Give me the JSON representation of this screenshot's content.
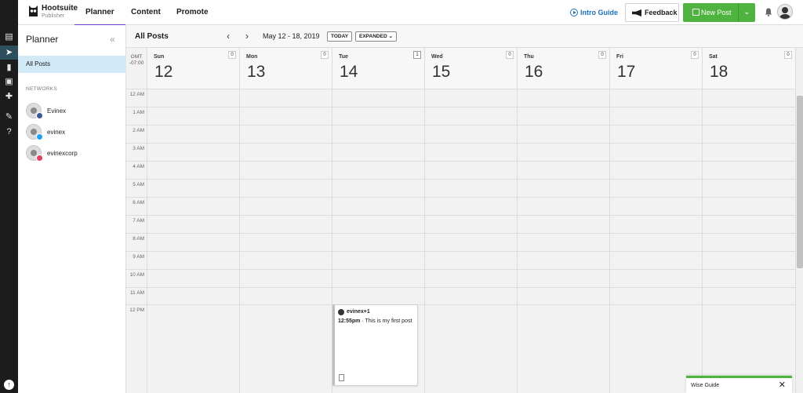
{
  "header": {
    "brand": "Hootsuite",
    "brand_sub": "Publisher",
    "tabs": [
      {
        "label": "Planner",
        "active": true
      },
      {
        "label": "Content",
        "active": false
      },
      {
        "label": "Promote",
        "active": false
      }
    ],
    "intro_guide": "Intro Guide",
    "feedback": "Feedback",
    "new_post": "New Post",
    "new_post_dropdown": "⌄",
    "accent_color": "#4fb33f"
  },
  "sidebar": {
    "title": "Planner",
    "collapse": "«",
    "all_posts": "All Posts",
    "networks_label": "NETWORKS",
    "networks": [
      {
        "name": "Evinex",
        "network": "facebook",
        "color": "#3b5998"
      },
      {
        "name": "evinex",
        "network": "twitter",
        "color": "#1da1f2"
      },
      {
        "name": "evinexcorp",
        "network": "instagram",
        "color": "#e4405f"
      }
    ]
  },
  "calendar": {
    "title": "All Posts",
    "prev": "‹",
    "next": "›",
    "range": "May 12 - 18, 2019",
    "today": "TODAY",
    "view": "EXPANDED",
    "view_caret": "⌄",
    "timezone_line1": "GMT",
    "timezone_line2": "-07:00",
    "days": [
      {
        "name": "Sun",
        "num": "12",
        "count": "0"
      },
      {
        "name": "Mon",
        "num": "13",
        "count": "0"
      },
      {
        "name": "Tue",
        "num": "14",
        "count": "1"
      },
      {
        "name": "Wed",
        "num": "15",
        "count": "0"
      },
      {
        "name": "Thu",
        "num": "16",
        "count": "0"
      },
      {
        "name": "Fri",
        "num": "17",
        "count": "0"
      },
      {
        "name": "Sat",
        "num": "18",
        "count": "0"
      }
    ],
    "hours": [
      "12 AM",
      "1 AM",
      "2 AM",
      "3 AM",
      "4 AM",
      "5 AM",
      "6 AM",
      "7 AM",
      "8 AM",
      "9 AM",
      "10 AM",
      "11 AM",
      "12 PM"
    ],
    "post": {
      "account": "evinex+1",
      "time": "12:55pm",
      "separator": " · ",
      "text": "This is my first post"
    }
  },
  "wise_guide": {
    "label": "Wise Guide",
    "close": "✕"
  }
}
